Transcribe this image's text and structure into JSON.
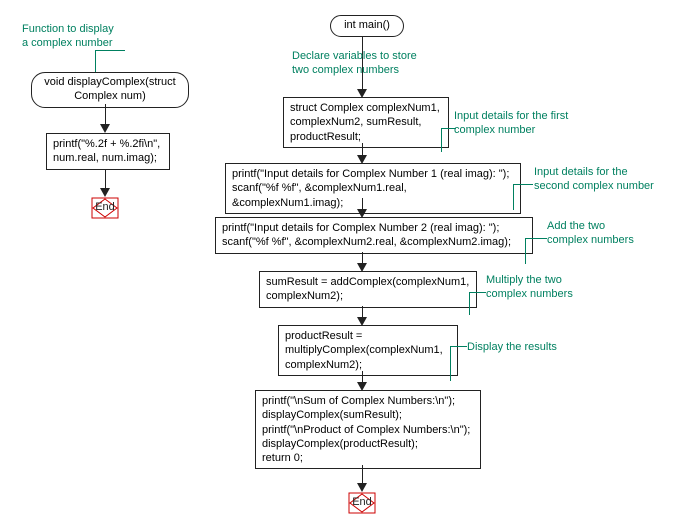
{
  "left": {
    "annotation1": "Function to display\na complex number",
    "node1": "void displayComplex(struct\nComplex num)",
    "box1": "printf(\"%.2f + %.2fi\\n\",\nnum.real, num.imag);",
    "end": "End"
  },
  "right": {
    "node1": "int main()",
    "annotation_declare": "Declare variables to store\ntwo complex numbers",
    "box1": "struct Complex complexNum1,\ncomplexNum2, sumResult,\nproductResult;",
    "annotation_input1": "Input details for the first\ncomplex number",
    "box2": "printf(\"Input details for Complex Number 1 (real imag): \");\nscanf(\"%f %f\", &complexNum1.real, &complexNum1.imag);",
    "annotation_input2": "Input details for the\nsecond complex number",
    "box3": "printf(\"Input details for Complex Number 2 (real imag): \");\nscanf(\"%f %f\", &complexNum2.real, &complexNum2.imag);",
    "annotation_add": "Add the two\ncomplex numbers",
    "box4": "sumResult = addComplex(complexNum1,\ncomplexNum2);",
    "annotation_mul": "Multiply the two\ncomplex numbers",
    "box5": "productResult =\nmultiplyComplex(complexNum1,\ncomplexNum2);",
    "annotation_disp": "Display the results",
    "box6": "printf(\"\\nSum of Complex Numbers:\\n\");\ndisplayComplex(sumResult);\nprintf(\"\\nProduct of Complex Numbers:\\n\");\ndisplayComplex(productResult);\nreturn 0;",
    "end": "End"
  }
}
